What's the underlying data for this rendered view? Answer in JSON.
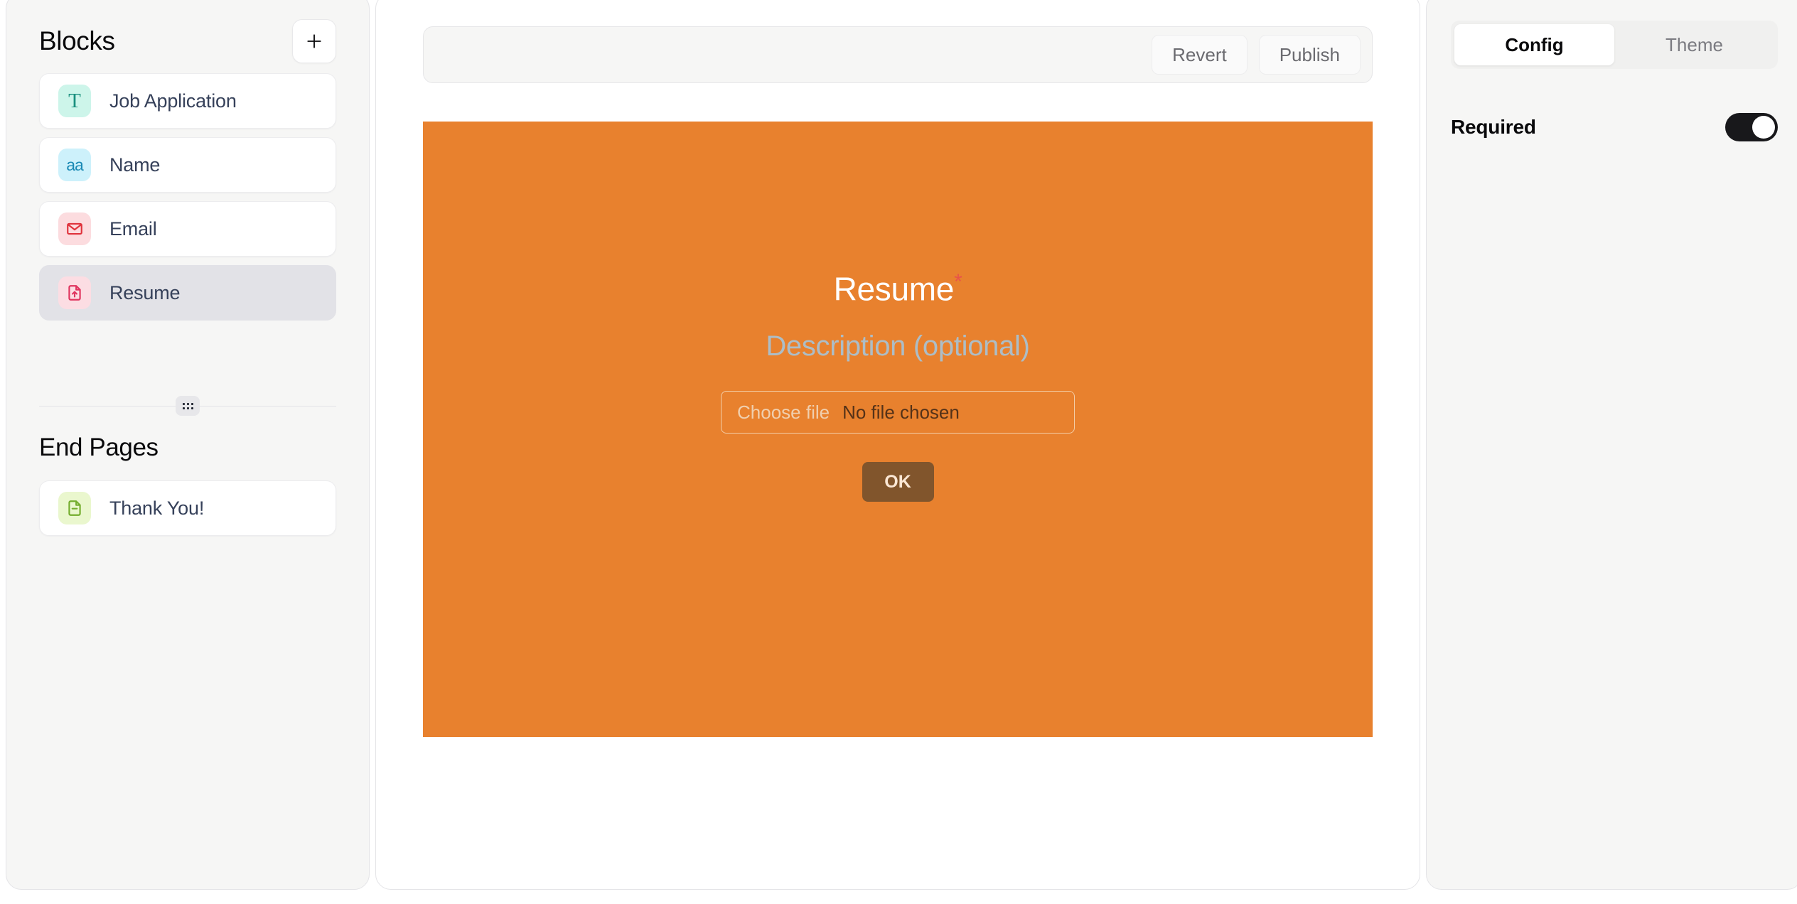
{
  "sidebar": {
    "title": "Blocks",
    "add_button_label": "+",
    "add_icon": "plus-icon",
    "drag_handle_icon": "drag-dots-icon",
    "blocks": [
      {
        "label": "Job Application",
        "icon": "text-heading-icon",
        "glyph": "T",
        "selected": false
      },
      {
        "label": "Name",
        "icon": "short-text-icon",
        "glyph": "aa",
        "selected": false
      },
      {
        "label": "Email",
        "icon": "envelope-icon",
        "glyph": "",
        "selected": false
      },
      {
        "label": "Resume",
        "icon": "file-upload-icon",
        "glyph": "",
        "selected": true
      }
    ],
    "end_pages_title": "End Pages",
    "end_pages": [
      {
        "label": "Thank You!",
        "icon": "document-minus-icon",
        "glyph": ""
      }
    ]
  },
  "toolbar": {
    "revert_label": "Revert",
    "publish_label": "Publish"
  },
  "canvas": {
    "background_color": "#e8812e",
    "title": "Resume",
    "required_marker": "*",
    "required_marker_color": "#e8534a",
    "description_placeholder": "Description (optional)",
    "file_input": {
      "button_label": "Choose file",
      "status_text": "No file chosen"
    },
    "submit_label": "OK"
  },
  "right_panel": {
    "tabs": [
      {
        "label": "Config",
        "active": true
      },
      {
        "label": "Theme",
        "active": false
      }
    ],
    "settings": [
      {
        "label": "Required",
        "type": "toggle",
        "value": "on"
      }
    ]
  }
}
